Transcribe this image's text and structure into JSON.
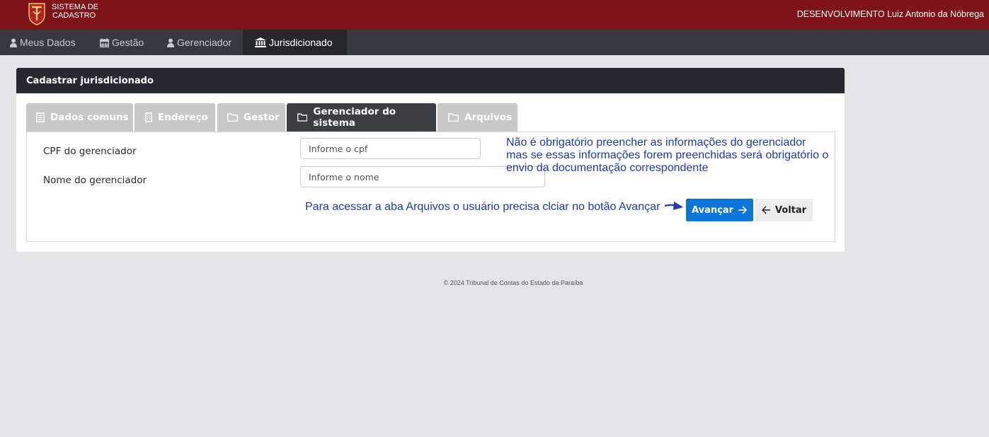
{
  "header": {
    "brand_line1": "SISTEMA DE",
    "brand_line2": "CADASTRO",
    "user": "DESENVOLVIMENTO Luiz Antonio da Nóbrega",
    "brand_color": "#7e1419"
  },
  "nav": {
    "items": [
      {
        "label": "Meus Dados",
        "icon": "user-icon"
      },
      {
        "label": "Gestão",
        "icon": "calendar-icon"
      },
      {
        "label": "Gerenciador",
        "icon": "user-icon"
      },
      {
        "label": "Jurisdicionado",
        "icon": "bank-icon",
        "active": true
      }
    ]
  },
  "card": {
    "title": "Cadastrar jurisdicionado",
    "tabs": [
      {
        "label": "Dados comuns",
        "icon": "document-icon"
      },
      {
        "label": "Endereço",
        "icon": "building-icon"
      },
      {
        "label": "Gestor",
        "icon": "folder-icon"
      },
      {
        "label": "Gerenciador do sistema",
        "icon": "folder-icon",
        "active": true
      },
      {
        "label": "Arquivos",
        "icon": "folder-icon"
      }
    ]
  },
  "form": {
    "cpf_label": "CPF do gerenciador",
    "cpf_placeholder": "Informe o cpf",
    "nome_label": "Nome do gerenciador",
    "nome_placeholder": "Informe o nome"
  },
  "annotations": {
    "note_line1": "Não é obrigatório preencher as informações do gerenciador",
    "note_line2": "mas se essas informações forem preenchidas será obrigatório o",
    "note_line3": "envio da documentação correspondente",
    "arrow_note": "Para acessar a aba Arquivos o usuário precisa clciar no botão Avançar"
  },
  "buttons": {
    "next": "Avançar",
    "back": "Voltar",
    "primary_color": "#0b76d8"
  },
  "footer": {
    "text": "© 2024 Tribunal de Contas do Estado da Paraíba"
  }
}
